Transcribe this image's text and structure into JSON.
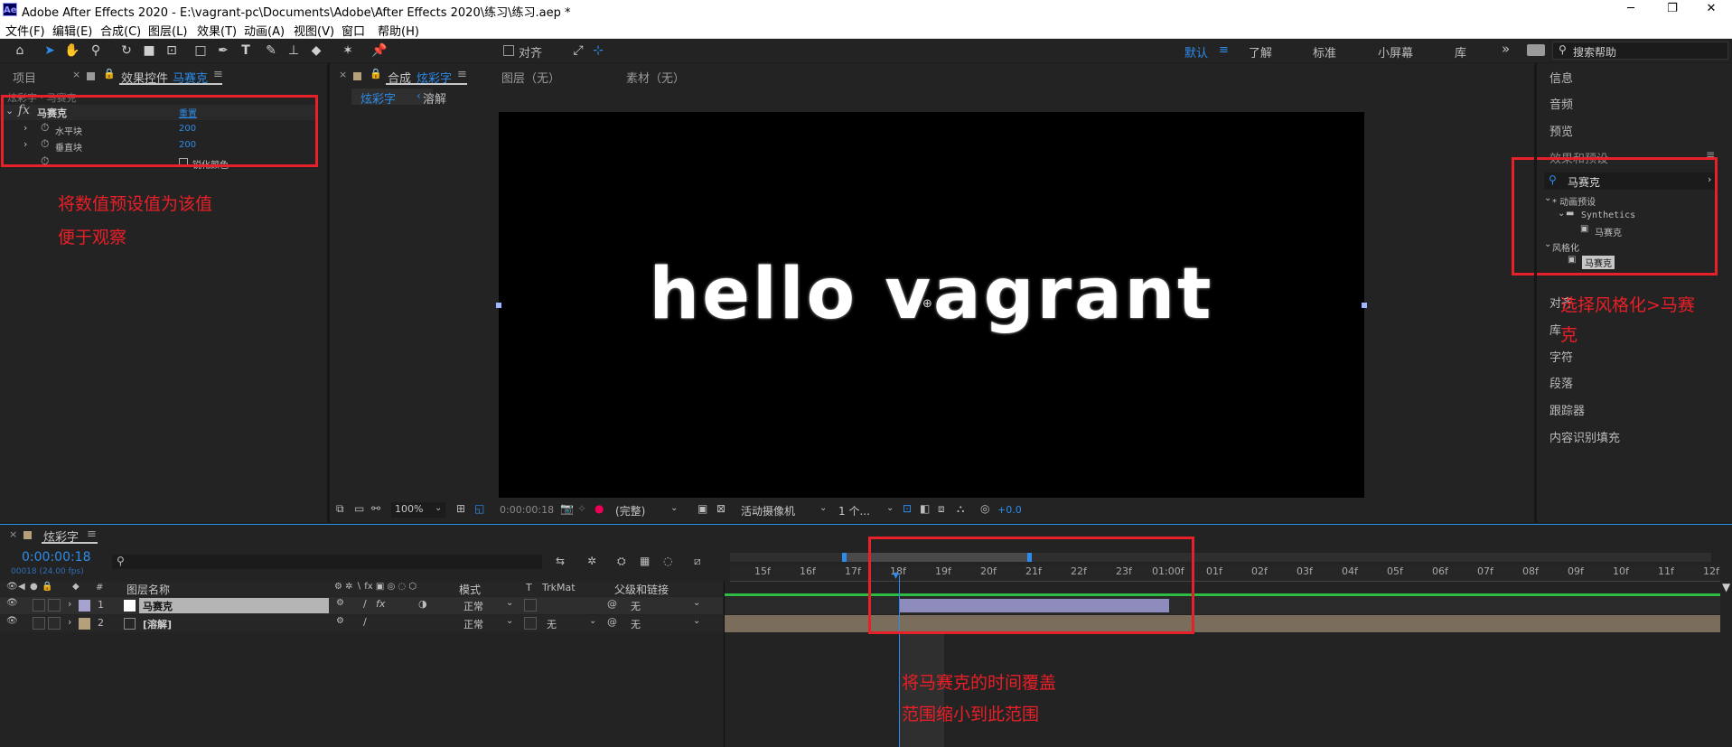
{
  "window": {
    "app_icon": "Ae",
    "title": "Adobe After Effects 2020 - E:\\vagrant-pc\\Documents\\Adobe\\After Effects 2020\\练习\\练习.aep *",
    "minimize": "─",
    "maximize": "❐",
    "close": "✕"
  },
  "menu": [
    "文件(F)",
    "编辑(E)",
    "合成(C)",
    "图层(L)",
    "效果(T)",
    "动画(A)",
    "视图(V)",
    "窗口",
    "帮助(H)"
  ],
  "toolbar": {
    "snap_label": "对齐",
    "workspaces": [
      "默认",
      "了解",
      "标准",
      "小屏幕",
      "库"
    ],
    "active_workspace": "默认",
    "overflow": "»",
    "search_placeholder": "搜索帮助"
  },
  "left_panel": {
    "tab_project": "项目",
    "tab_effect_prefix": "效果控件",
    "tab_effect_layer": "马赛克",
    "breadcrumb": "炫彩字 · 马赛克",
    "effect": {
      "fx": "fx",
      "name": "马赛克",
      "reset": "重置",
      "props": [
        {
          "label": "水平块",
          "value": "200"
        },
        {
          "label": "垂直块",
          "value": "200"
        }
      ],
      "sharpen_label": "锐化颜色"
    },
    "annotation_lines": [
      "将数值预设值为该值",
      "便于观察"
    ]
  },
  "composition": {
    "tab_prefix": "合成",
    "tab_name": "炫彩字",
    "layer_tab": "图层（无）",
    "footage_tab": "素材（无）",
    "nav_active": "炫彩字",
    "nav_other": "溶解",
    "canvas_text": "hello vagrant",
    "zoom": "100%",
    "timecode": "0:00:00:18",
    "resolution": "(完整)",
    "camera": "活动摄像机",
    "views": "1 个...",
    "exposure": "+0.0"
  },
  "right_panel": {
    "items_top": [
      "信息",
      "音频",
      "预览"
    ],
    "effects_title": "效果和预设",
    "search_value": "马赛克",
    "tree": [
      {
        "label": "* 动画预设",
        "level": 0
      },
      {
        "label": "Synthetics",
        "level": 1
      },
      {
        "label": "马赛克",
        "level": 2
      },
      {
        "label": "风格化",
        "level": 0
      },
      {
        "label": "马赛克",
        "level": 1,
        "selected": true
      }
    ],
    "items_bottom": [
      "对齐",
      "库",
      "字符",
      "段落",
      "跟踪器",
      "内容识别填充"
    ],
    "annotation_lines": [
      "选择风格化>马赛",
      "克"
    ]
  },
  "timeline": {
    "tab_name": "炫彩字",
    "timecode": "0:00:00:18",
    "frame_info": "00018 (24.00 fps)",
    "columns": {
      "name": "图层名称",
      "mode": "模式",
      "t": "T",
      "trkmat": "TrkMat",
      "parent": "父级和链接"
    },
    "layers": [
      {
        "num": "1",
        "name": "马赛克",
        "mode": "正常",
        "trkmat": "",
        "parent": "无",
        "label_color": "#a6a3cf"
      },
      {
        "num": "2",
        "name": "[溶解]",
        "mode": "正常",
        "trkmat": "无",
        "parent": "无",
        "label_color": "#b5a07c"
      }
    ],
    "ruler_ticks": [
      "15f",
      "16f",
      "17f",
      "18f",
      "19f",
      "20f",
      "21f",
      "22f",
      "23f",
      "01:00f",
      "01f",
      "02f",
      "03f",
      "04f",
      "05f",
      "06f",
      "07f",
      "08f",
      "09f",
      "10f",
      "11f",
      "12f"
    ],
    "annotation_lines": [
      "将马赛克的时间覆盖",
      "范围缩小到此范围"
    ]
  },
  "colors": {
    "accent_blue": "#2d8ceb",
    "annotation_red": "#e8202a",
    "layer1_bar": "#8e8bbd",
    "layer2_bar": "#7a6d5c",
    "green_line": "#2ebc45"
  }
}
